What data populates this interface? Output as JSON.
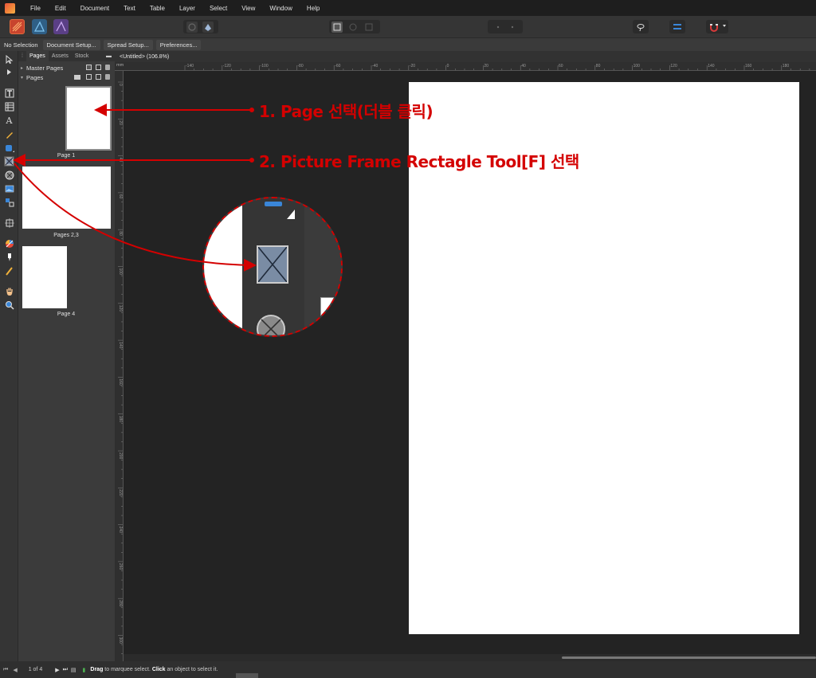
{
  "menubar": {
    "items": [
      "File",
      "Edit",
      "Document",
      "Text",
      "Table",
      "Layer",
      "Select",
      "View",
      "Window",
      "Help"
    ]
  },
  "contextbar": {
    "selection_label": "No Selection",
    "buttons": [
      "Document Setup...",
      "Spread Setup...",
      "Preferences..."
    ]
  },
  "panel": {
    "tabs": [
      "Pages",
      "Assets",
      "Stock"
    ],
    "master_pages_label": "Master Pages",
    "pages_label": "Pages",
    "thumbnails": [
      {
        "label": "Page 1"
      },
      {
        "label": "Pages 2,3"
      },
      {
        "label": "Page 4"
      }
    ]
  },
  "document": {
    "tab_title": "<Untitled> (106.8%)",
    "ruler_unit": "mm",
    "top_ticks": [
      "-140",
      "-120",
      "-100",
      "-80",
      "-60",
      "-40",
      "-20",
      "0",
      "20",
      "40",
      "60",
      "80",
      "100",
      "120",
      "140",
      "160",
      "180",
      "200"
    ],
    "left_ticks": [
      "0",
      "20",
      "40",
      "60",
      "80",
      "100",
      "120",
      "140",
      "160",
      "180",
      "200",
      "220",
      "240",
      "260",
      "280",
      "300"
    ]
  },
  "statusbar": {
    "page_counter": "1 of 4",
    "hint_bold_1": "Drag",
    "hint_text_1": " to marquee select. ",
    "hint_bold_2": "Click",
    "hint_text_2": " an object to select it."
  },
  "annotations": {
    "step1": "1. Page 선택(더블 클릭)",
    "step2": "2. Picture Frame Rectagle Tool[F] 선택"
  },
  "colors": {
    "annotation_red": "#d40000",
    "accent_blue": "#3a86d8"
  }
}
